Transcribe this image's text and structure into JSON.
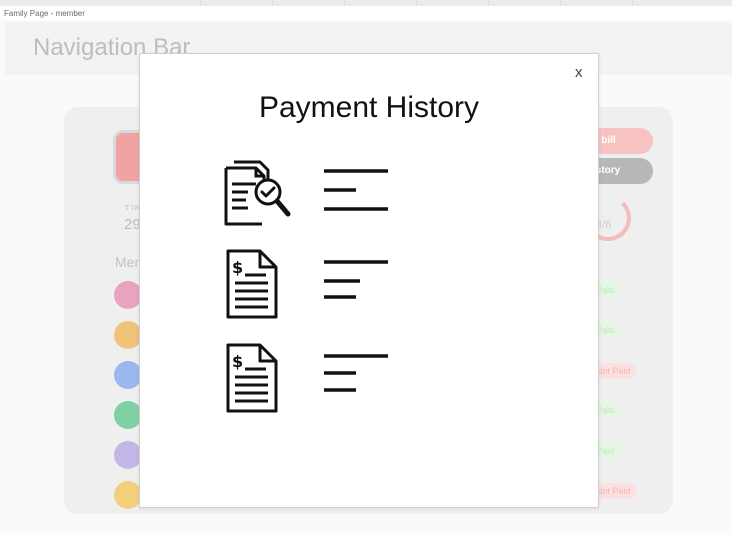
{
  "frame_label": "Family Page - member",
  "navbar": {
    "title": "Navigation Bar"
  },
  "background": {
    "small_label": "ราค",
    "big_number": "29",
    "members_label": "Men",
    "buttons": {
      "pay": "y bill",
      "history": "istory"
    },
    "progress_text": "4/6",
    "statuses": [
      {
        "text": "Paid",
        "type": "paid"
      },
      {
        "text": "Paid",
        "type": "paid"
      },
      {
        "text": "Not Paid",
        "type": "notpaid"
      },
      {
        "text": "Paid",
        "type": "paid"
      },
      {
        "text": "Paid",
        "type": "paid"
      },
      {
        "text": "Not Paid",
        "type": "notpaid"
      }
    ],
    "avatar_colors": [
      "#e9a2c0",
      "#f0c27a",
      "#9bb7f0",
      "#7fd1a3",
      "#c4b6e8",
      "#f3cf7b"
    ]
  },
  "modal": {
    "title": "Payment History",
    "close_label": "x",
    "entries": [
      {
        "icon": "document-search-icon"
      },
      {
        "icon": "receipt-dollar-icon"
      },
      {
        "icon": "receipt-dollar-icon"
      }
    ]
  },
  "colors": {
    "pay_button": "#f6c2c2",
    "history_button": "#b7b7b7",
    "paid_badge": "#e3f7e3",
    "not_paid_badge": "#fbe1e1"
  }
}
